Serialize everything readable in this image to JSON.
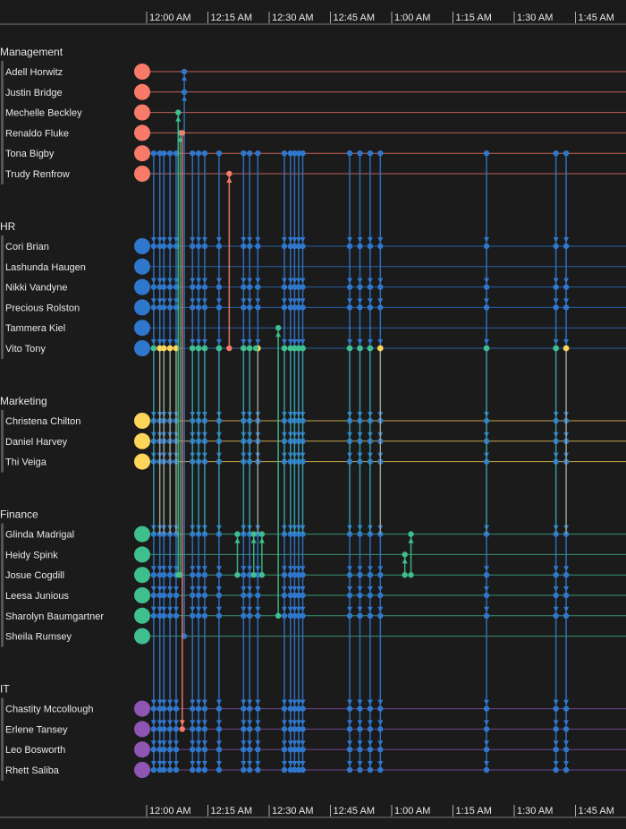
{
  "axis": {
    "ticks": [
      "12:00 AM",
      "12:15 AM",
      "12:30 AM",
      "12:45 AM",
      "1:00 AM",
      "1:15 AM",
      "1:30 AM",
      "1:45 AM"
    ]
  },
  "groups": [
    {
      "name": "Management",
      "color": "#f87b6a",
      "people": [
        "Adell Horwitz",
        "Justin Bridge",
        "Mechelle Beckley",
        "Renaldo Fluke",
        "Tona Bigby",
        "Trudy Renfrow"
      ]
    },
    {
      "name": "HR",
      "color": "#2f77cc",
      "people": [
        "Cori Brian",
        "Lashunda Haugen",
        "Nikki Vandyne",
        "Precious Rolston",
        "Tammera Kiel",
        "Vito Tony"
      ]
    },
    {
      "name": "Marketing",
      "color": "#fdd55a",
      "people": [
        "Christena Chilton",
        "Daniel Harvey",
        "Thi Veiga"
      ]
    },
    {
      "name": "Finance",
      "color": "#3fbf8e",
      "people": [
        "Glinda Madrigal",
        "Heidy Spink",
        "Josue Cogdill",
        "Leesa Junious",
        "Sharolyn Baumgartner",
        "Sheila Rumsey"
      ]
    },
    {
      "name": "IT",
      "color": "#8e55b3",
      "people": [
        "Chastity Mccollough",
        "Erlene Tansey",
        "Leo Bosworth",
        "Rhett Saliba"
      ]
    }
  ],
  "broadcast": {
    "sender": "Tona Bigby",
    "recipients": [
      "Cori Brian",
      "Nikki Vandyne",
      "Precious Rolston",
      "Vito Tony",
      "Christena Chilton",
      "Daniel Harvey",
      "Thi Veiga",
      "Glinda Madrigal",
      "Josue Cogdill",
      "Leesa Junious",
      "Sharolyn Baumgartner",
      "Chastity Mccollough",
      "Erlene Tansey",
      "Leo Bosworth",
      "Rhett Saliba"
    ],
    "color": "#2f77cc",
    "times": [
      "12:01:30",
      "12:03",
      "12:04",
      "12:05:30",
      "12:07",
      "12:11",
      "12:12:30",
      "12:14",
      "12:17:30",
      "12:23:30",
      "12:25",
      "12:27",
      "12:33:30",
      "12:35",
      "12:36",
      "12:37",
      "12:38",
      "12:49:30",
      "12:52",
      "12:54:30",
      "12:57",
      "1:23",
      "1:40",
      "1:42:30"
    ],
    "vito_colors": [
      "#3fbf8e",
      "#fdd55a",
      "#fdd55a",
      "#fdd55a",
      "#fdd55a",
      "#3fbf8e",
      "#3fbf8e",
      "#3fbf8e",
      "#3fbf8e",
      "#3fbf8e",
      "#3fbf8e",
      "#fdd55a",
      "#3fbf8e",
      "#3fbf8e",
      "#3fbf8e",
      "#3fbf8e",
      "#3fbf8e",
      "#3fbf8e",
      "#3fbf8e",
      "#3fbf8e",
      "#fdd55a",
      "#3fbf8e",
      "#3fbf8e",
      "#fdd55a"
    ]
  },
  "events": [
    {
      "time": "12:09",
      "from": "Sheila Rumsey",
      "to": [
        "Adell Horwitz",
        "Justin Bridge"
      ],
      "color": "#2f77cc"
    },
    {
      "time": "12:07:30",
      "from": "Josue Cogdill",
      "to": [
        "Mechelle Beckley"
      ],
      "color": "#3fbf8e"
    },
    {
      "time": "12:08",
      "from": "Josue Cogdill",
      "to": [
        "Renaldo Fluke"
      ],
      "color": "#3fbf8e"
    },
    {
      "time": "12:08:30",
      "from": "Renaldo Fluke",
      "to": [
        "Erlene Tansey"
      ],
      "color": "#f87b6a"
    },
    {
      "time": "12:20",
      "from": "Vito Tony",
      "to": [
        "Trudy Renfrow"
      ],
      "color": "#f87b6a"
    },
    {
      "time": "12:32",
      "from": "Sharolyn Baumgartner",
      "to": [
        "Tammera Kiel"
      ],
      "color": "#3fbf8e"
    },
    {
      "time": "12:22",
      "from": "Josue Cogdill",
      "to": [
        "Glinda Madrigal"
      ],
      "color": "#3fbf8e"
    },
    {
      "time": "12:26",
      "from": "Josue Cogdill",
      "to": [
        "Glinda Madrigal"
      ],
      "color": "#3fbf8e"
    },
    {
      "time": "12:28",
      "from": "Josue Cogdill",
      "to": [
        "Glinda Madrigal"
      ],
      "color": "#3fbf8e"
    },
    {
      "time": "12:26:30",
      "from": "Vito Tony",
      "to": [
        "Vito Tony"
      ],
      "color": "#3fbf8e"
    },
    {
      "time": "1:03",
      "from": "Josue Cogdill",
      "to": [
        "Heidy Spink"
      ],
      "color": "#3fbf8e"
    },
    {
      "time": "1:04:30",
      "from": "Josue Cogdill",
      "to": [
        "Glinda Madrigal"
      ],
      "color": "#3fbf8e"
    }
  ]
}
